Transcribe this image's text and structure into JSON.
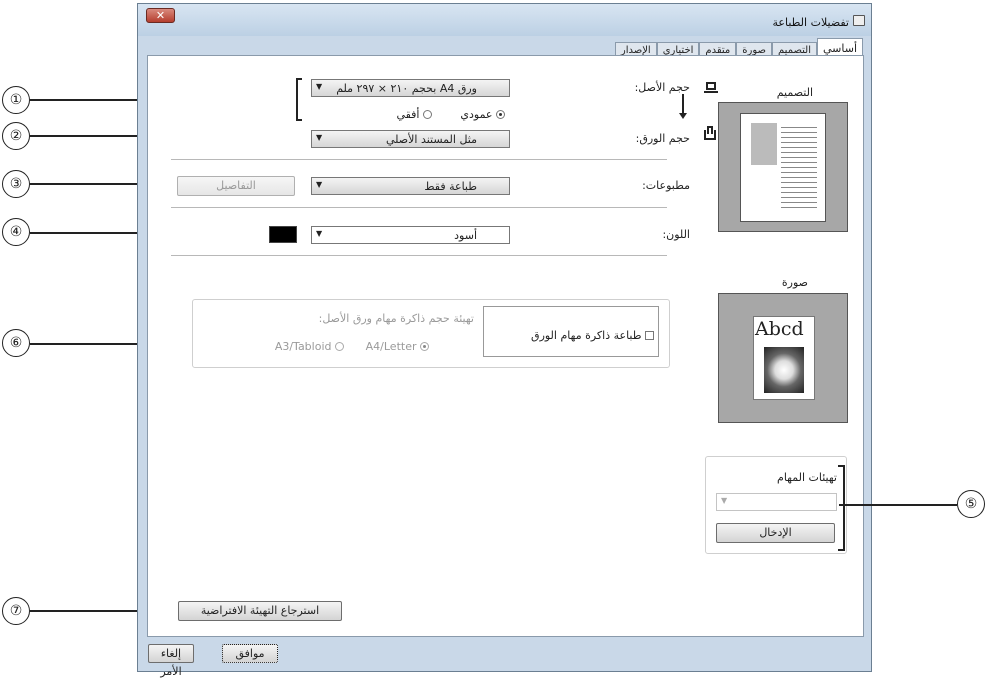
{
  "window": {
    "title": "تفضيلات الطباعة",
    "close_label": "✕"
  },
  "tabs": [
    {
      "label": "أساسي",
      "active": true
    },
    {
      "label": "التصميم"
    },
    {
      "label": "صورة"
    },
    {
      "label": "متقدم"
    },
    {
      "label": "اختياري"
    },
    {
      "label": "الإصدار"
    }
  ],
  "basic": {
    "original_size_label": "حجم الأصل:",
    "original_size_value": "ورق A4 بحجم ٢١٠ × ٢٩٧ ملم",
    "orientation_portrait": "عمودي",
    "orientation_landscape": "أفقي",
    "paper_size_label": "حجم الورق:",
    "paper_size_value": "مثل المستند الأصلي",
    "output_label": "مطبوعات:",
    "output_value": "طباعة فقط",
    "details_button": "التفاصيل",
    "color_label": "اللون:",
    "color_value": "أسود",
    "job_memory_checkbox": "طباعة ذاكرة مهام الورق",
    "job_memory_desc": "تهيئة حجم ذاكرة مهام ورق الأصل:",
    "option_a4_letter": "A4/Letter",
    "option_a3_tabloid": "A3/Tabloid",
    "restore_defaults": "استرجاع التهيئة الافتراضية"
  },
  "side": {
    "layout_title": "التصميم",
    "image_title": "صورة",
    "image_sample_text": "Abcd",
    "job_settings_title": "تهيئات المهام",
    "enter_button": "الإدخال"
  },
  "footer": {
    "ok_button": "موافق",
    "cancel_button": "إلغاء الأمر"
  },
  "callouts": [
    "①",
    "②",
    "③",
    "④",
    "⑤",
    "⑥",
    "⑦"
  ],
  "colors": {
    "swatch": "#000000",
    "preview_bg": "#a7a7a7"
  }
}
